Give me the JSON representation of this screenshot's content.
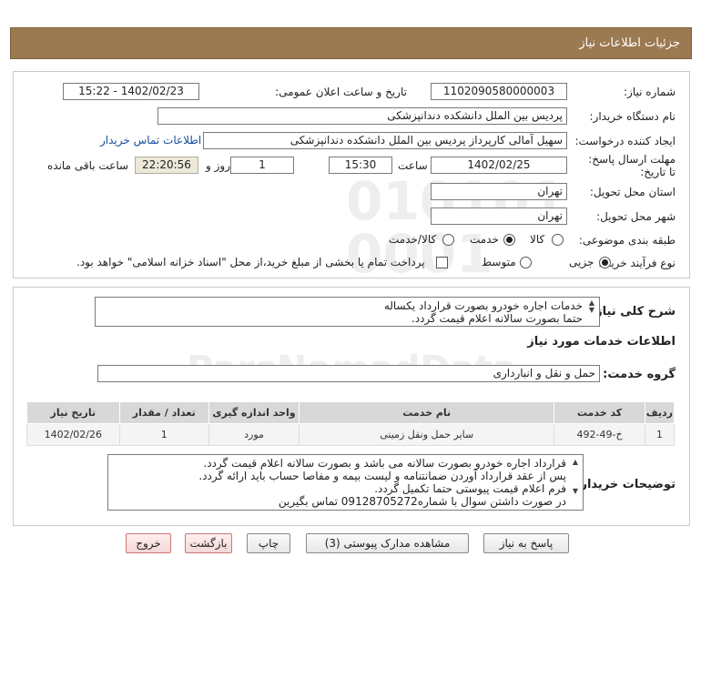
{
  "header": {
    "title": "جزئیات اطلاعات نیاز"
  },
  "form": {
    "need_number_label": "شماره نیاز:",
    "need_number": "1102090580000003",
    "announce_label": "تاریخ و ساعت اعلان عمومی:",
    "announce_value": "1402/02/23 - 15:22",
    "buyer_org_label": "نام دستگاه خریدار:",
    "buyer_org": "پردیس بین الملل دانشکده دندانپزشکی",
    "creator_label": "ایجاد کننده درخواست:",
    "creator": "سهیل آمالی کارپرداز پردیس بین الملل دانشکده دندانپزشکی",
    "contact_link": "اطلاعات تماس خریدار",
    "deadline_label": "مهلت ارسال پاسخ: تا تاریخ:",
    "deadline_date": "1402/02/25",
    "time_label": "ساعت",
    "deadline_time": "15:30",
    "days_value": "1",
    "days_label": "روز و",
    "remaining_time": "22:20:56",
    "remaining_label": "ساعت باقی مانده",
    "province_label": "استان محل تحویل:",
    "province": "تهران",
    "city_label": "شهر محل تحویل:",
    "city": "تهران",
    "category_label": "طبقه بندی موضوعی:",
    "category_options": [
      "کالا",
      "خدمت",
      "کالا/خدمت"
    ],
    "category_selected": "خدمت",
    "process_label": "نوع فرآیند خرید :",
    "process_options": [
      "جزیی",
      "متوسط"
    ],
    "process_selected": "جزیی",
    "payment_note": "پرداخت تمام یا بخشی از مبلغ خرید،از محل \"اسناد خزانه اسلامی\" خواهد بود."
  },
  "summary": {
    "label": "شرح کلی نیاز:",
    "lines": [
      "خدمات اجاره خودرو بصورت قرارداد یکساله",
      "حتما بصورت سالانه اعلام قیمت گردد."
    ]
  },
  "services": {
    "section_title": "اطلاعات خدمات مورد نیاز",
    "group_label": "گروه خدمت:",
    "group_value": "حمل و نقل و انبارداری",
    "columns": [
      "ردیف",
      "کد خدمت",
      "نام خدمت",
      "واحد اندازه گیری",
      "تعداد / مقدار",
      "تاریخ نیاز"
    ],
    "rows": [
      [
        "1",
        "خ-49-492",
        "سایر حمل ونقل زمینی",
        "مورد",
        "1",
        "1402/02/26"
      ]
    ]
  },
  "notes": {
    "label": "توضیحات خریدار:",
    "lines": [
      "قرارداد اجاره خودرو بصورت سالانه می باشد و بصورت سالانه اعلام قیمت گردد.",
      "پس از عقد قرارداد آوردن ضمانتنامه و لیست بیمه و مفاصا حساب باید ارائه گردد.",
      "فرم اعلام قیمت پیوستی حتما تکمیل گردد.",
      "در صورت داشتن سوال با شماره09128705272 تماس بگیرین"
    ]
  },
  "buttons": {
    "reply": "پاسخ به نیاز",
    "attachments": "مشاهده مدارک پیوستی (3)",
    "print": "چاپ",
    "back": "بازگشت",
    "exit": "خروج"
  }
}
